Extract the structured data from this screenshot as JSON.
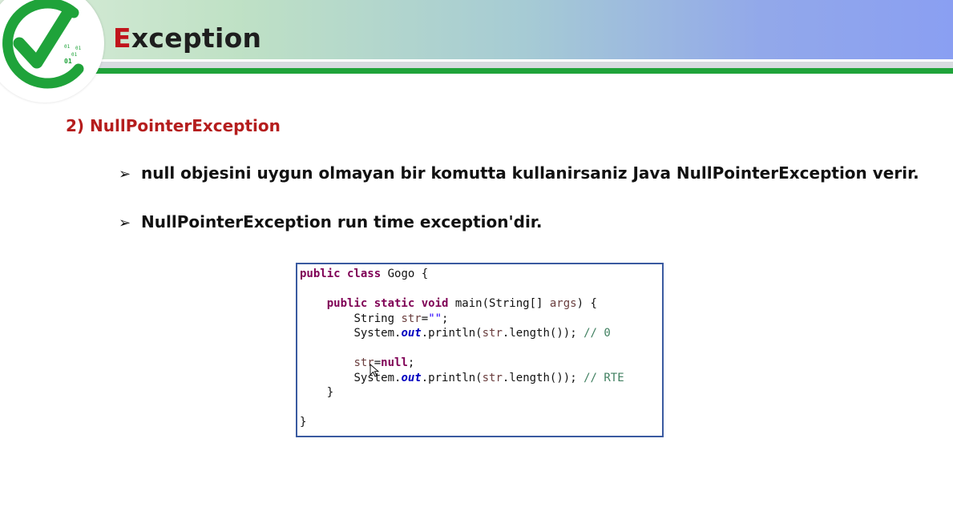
{
  "header": {
    "title_first_letter": "E",
    "title_rest": "xception",
    "logo_binary": [
      "01",
      "01",
      "01",
      "01"
    ]
  },
  "section": {
    "heading": "2) NullPointerException"
  },
  "bullets": [
    "null objesini uygun olmayan bir komutta kullanirsaniz Java NullPointerException verir.",
    "NullPointerException run time exception'dir."
  ],
  "bullet_marker": "➢",
  "code": {
    "l1_kw": "public class",
    "l1_rest": " Gogo {",
    "l3_kw": "public static void",
    "l3_rest": " main(String[] ",
    "l3_var": "args",
    "l3_end": ") {",
    "l4_type": "String ",
    "l4_var": "str",
    "l4_eq": "=",
    "l4_str": "\"\"",
    "l4_end": ";",
    "l5_a": "System.",
    "l5_fld": "out",
    "l5_b": ".println(",
    "l5_var": "str",
    "l5_c": ".length()); ",
    "l5_cmt": "// 0",
    "l7_var": "str",
    "l7_eq": "=",
    "l7_kw": "null",
    "l7_end": ";",
    "l8_a": "System.",
    "l8_fld": "out",
    "l8_b": ".println(",
    "l8_var": "str",
    "l8_c": ".length()); ",
    "l8_cmt": "// RTE",
    "l9": "}",
    "l11": "}"
  }
}
